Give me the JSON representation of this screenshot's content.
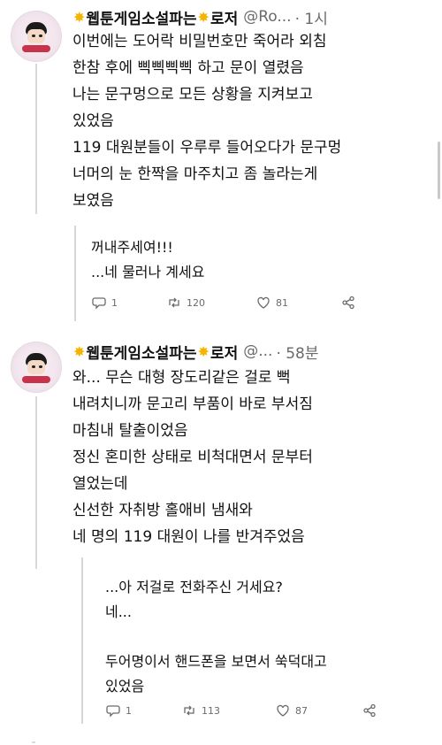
{
  "tweets": [
    {
      "display_name": "웹툰게임소설파는",
      "display_name_tail": "로저",
      "handle": "@Ro...",
      "time": "· 1시",
      "body": "이번에는 도어락 비밀번호만 죽어라 외침\n한참 후에 삑삑삑삑 하고 문이 열렸음\n나는 문구멍으로 모든 상황을 지켜보고\n있었음\n119 대원분들이 우루루 들어오다가 문구멍\n너머의 눈 한짝을 마주치고 좀 놀라는게\n보였음",
      "reply": "꺼내주세여!!!\n...네 물러나 계세요",
      "stats": {
        "replies": "1",
        "retweets": "120",
        "likes": "81"
      }
    },
    {
      "display_name": "웹툰게임소설파는",
      "display_name_tail": "로저",
      "handle": "@...",
      "time": "· 58분",
      "body": "와... 무슨 대형 장도리같은 걸로 뻑\n내려치니까 문고리 부품이 바로 부서짐\n마침내 탈출이었음\n정신 혼미한 상태로 비척대면서 문부터\n열었는데\n신선한 자취방 홀애비 냄새와\n네 명의 119 대원이 나를 반겨주었음",
      "reply": "...아 저걸로 전화주신 거세요?\n네...\n\n두어명이서 핸드폰을 보면서 쑥덕대고\n있었음",
      "stats": {
        "replies": "1",
        "retweets": "113",
        "likes": "87"
      }
    }
  ],
  "icons": {
    "reply": "comment-icon",
    "retweet": "retweet-icon",
    "like": "heart-icon",
    "share": "share-icon",
    "star": "star-emoji-icon"
  },
  "colors": {
    "star": "#f5b400",
    "muted": "#6a6a6a",
    "text": "#111111"
  }
}
